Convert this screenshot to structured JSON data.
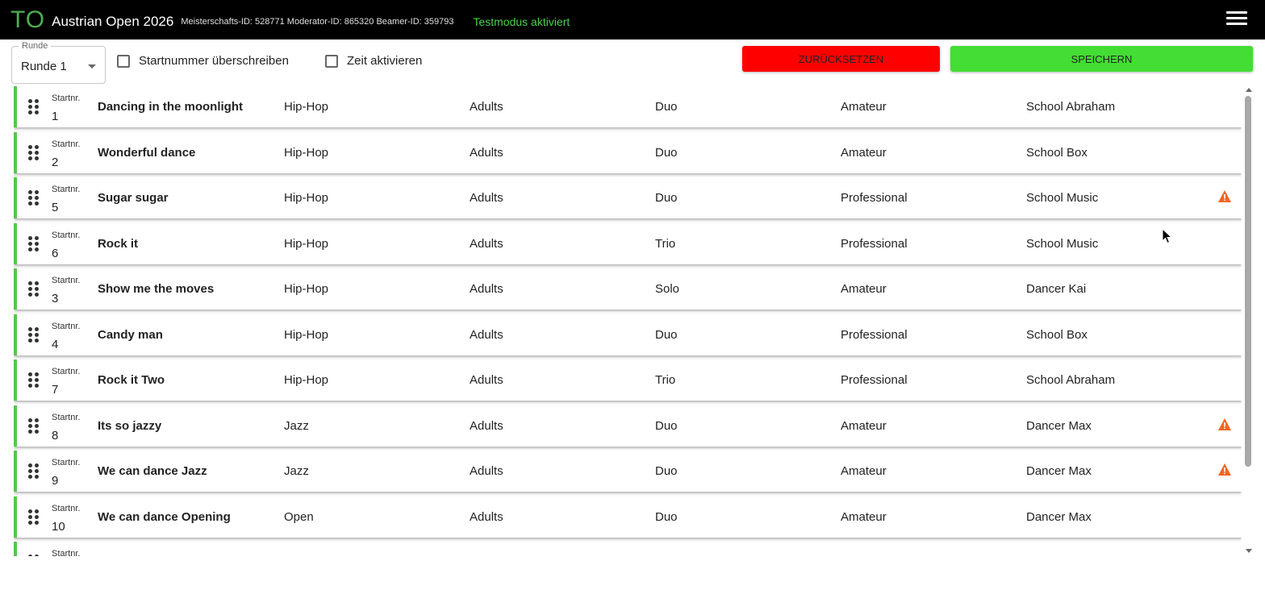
{
  "header": {
    "logo": "TO",
    "title": "Austrian Open 2026",
    "ids": "Meisterschafts-ID: 528771 Moderator-ID: 865320 Beamer-ID: 359793",
    "testmode": "Testmodus aktiviert",
    "menu_icon": "hamburger-menu-icon"
  },
  "toolbar": {
    "round_label": "Runde",
    "round_value": "Runde 1",
    "override_label": "Startnummer überschreiben",
    "override_checked": false,
    "time_label": "Zeit aktivieren",
    "time_checked": false,
    "reset_label": "ZURÜCKSETZEN",
    "save_label": "SPEICHERN"
  },
  "colors": {
    "header_bg": "#000000",
    "accent_green": "#53c84a",
    "reset_red": "#ff0000",
    "save_green": "#44dd33",
    "warning_orange": "#f26522"
  },
  "list": {
    "start_label": "Startnr.",
    "rows": [
      {
        "start": "1",
        "title": "Dancing in the moonlight",
        "genre": "Hip-Hop",
        "age": "Adults",
        "type": "Duo",
        "level": "Amateur",
        "school": "School Abraham",
        "warning": false
      },
      {
        "start": "2",
        "title": "Wonderful dance",
        "genre": "Hip-Hop",
        "age": "Adults",
        "type": "Duo",
        "level": "Amateur",
        "school": "School Box",
        "warning": false
      },
      {
        "start": "5",
        "title": "Sugar sugar",
        "genre": "Hip-Hop",
        "age": "Adults",
        "type": "Duo",
        "level": "Professional",
        "school": "School Music",
        "warning": true
      },
      {
        "start": "6",
        "title": "Rock it",
        "genre": "Hip-Hop",
        "age": "Adults",
        "type": "Trio",
        "level": "Professional",
        "school": "School Music",
        "warning": false
      },
      {
        "start": "3",
        "title": "Show me the moves",
        "genre": "Hip-Hop",
        "age": "Adults",
        "type": "Solo",
        "level": "Amateur",
        "school": "Dancer Kai",
        "warning": false
      },
      {
        "start": "4",
        "title": "Candy man",
        "genre": "Hip-Hop",
        "age": "Adults",
        "type": "Duo",
        "level": "Professional",
        "school": "School Box",
        "warning": false
      },
      {
        "start": "7",
        "title": "Rock it Two",
        "genre": "Hip-Hop",
        "age": "Adults",
        "type": "Trio",
        "level": "Professional",
        "school": "School Abraham",
        "warning": false
      },
      {
        "start": "8",
        "title": "Its so jazzy",
        "genre": "Jazz",
        "age": "Adults",
        "type": "Duo",
        "level": "Amateur",
        "school": "Dancer Max",
        "warning": true
      },
      {
        "start": "9",
        "title": "We can dance Jazz",
        "genre": "Jazz",
        "age": "Adults",
        "type": "Duo",
        "level": "Amateur",
        "school": "Dancer Max",
        "warning": true
      },
      {
        "start": "10",
        "title": "We can dance Opening",
        "genre": "Open",
        "age": "Adults",
        "type": "Duo",
        "level": "Amateur",
        "school": "Dancer Max",
        "warning": false
      },
      {
        "start": "",
        "title": "",
        "genre": "",
        "age": "",
        "type": "",
        "level": "",
        "school": "",
        "warning": false
      }
    ]
  }
}
